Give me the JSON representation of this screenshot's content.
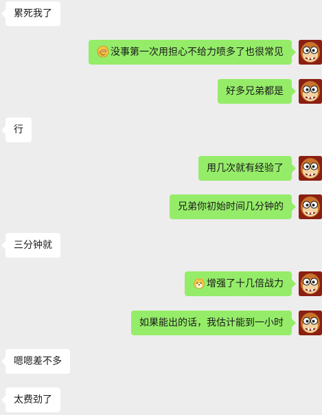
{
  "messages": [
    {
      "side": "left",
      "text": "累死我了"
    },
    {
      "side": "right",
      "text": "没事第一次用担心不给力喷多了也很常见",
      "emoji": "facepalm-emoji"
    },
    {
      "side": "right",
      "text": "好多兄弟都是"
    },
    {
      "side": "left",
      "text": "行"
    },
    {
      "side": "right",
      "text": "用几次就有经验了"
    },
    {
      "side": "right",
      "text": "兄弟你初始时间几分钟的"
    },
    {
      "side": "left",
      "text": "三分钟就"
    },
    {
      "side": "right",
      "text": "增强了十几倍战力",
      "emoji": "doge-emoji"
    },
    {
      "side": "right",
      "text": "如果能出的话，我估计能到一小时"
    },
    {
      "side": "left",
      "text": "嗯嗯差不多"
    },
    {
      "side": "left",
      "text": "太费劲了"
    }
  ],
  "avatar_icon": "cartoon-monkey-avatar-icon",
  "colors": {
    "background": "#ededed",
    "sent_bubble": "#95ec69",
    "received_bubble": "#ffffff",
    "avatar_bg": "#8a1f12"
  }
}
